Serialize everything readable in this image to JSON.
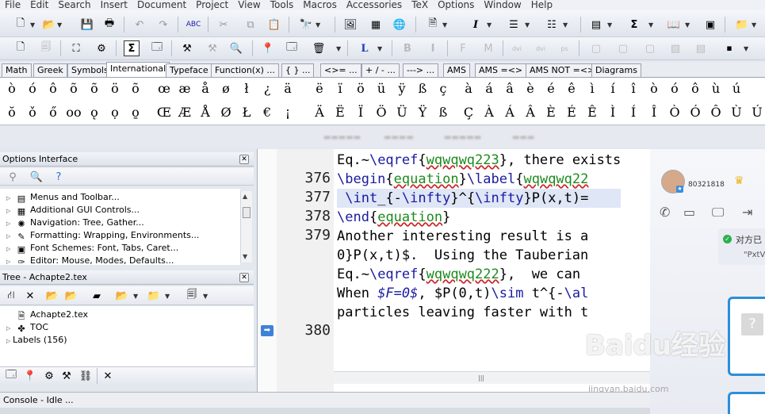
{
  "menu": [
    "File",
    "Edit",
    "Search",
    "Insert",
    "Document",
    "Project",
    "View",
    "Tools",
    "Macros",
    "Accessories",
    "TeX",
    "Options",
    "Window",
    "Help"
  ],
  "symbol_tabs": [
    "Math",
    "Greek",
    "Symbols",
    "International",
    "Typeface",
    "Function(x) ...",
    "{ } ...",
    "<>= ...",
    "+ / - ...",
    "---> ...",
    "AMS",
    "AMS =<>",
    "AMS NOT =<>",
    "Diagrams"
  ],
  "active_symbol_tab": "International",
  "symbols_row1": [
    "ò",
    "ó",
    "ô",
    "õ",
    "õ",
    "ö",
    "õ",
    "œ",
    "æ",
    "å",
    "ø",
    "ł",
    "¿",
    "ä",
    "ë",
    "ï",
    "ö",
    "ü",
    "ÿ",
    "ß",
    "ç",
    "à",
    "á",
    "â",
    "è",
    "é",
    "ê",
    "ì",
    "í",
    "î",
    "ò",
    "ó",
    "ô",
    "ù",
    "ú"
  ],
  "symbols_row2": [
    "ŏ",
    "ǒ",
    "ő",
    "oo",
    "ǫ",
    "ọ",
    "o̱",
    "Œ",
    "Æ",
    "Å",
    "Ø",
    "Ł",
    "€",
    "¡",
    "Ä",
    "Ë",
    "Ï",
    "Ö",
    "Ü",
    "Ÿ",
    "ß",
    "Ç",
    "À",
    "Á",
    "Â",
    "È",
    "É",
    "Ê",
    "Ì",
    "Í",
    "Î",
    "Ò",
    "Ó",
    "Ô",
    "Ù",
    "Ú"
  ],
  "options_panel": {
    "title": "Options Interface",
    "items": [
      "Menus and Toolbar...",
      "Additional GUI Controls...",
      "Navigation: Tree, Gather...",
      "Formatting: Wrapping, Environments...",
      "Font Schemes: Font, Tabs, Caret...",
      "Editor: Mouse, Modes, Defaults..."
    ]
  },
  "tree_panel": {
    "title": "Tree - Achapte2.tex",
    "items": [
      "Achapte2.tex",
      "TOC",
      "Labels  (156)"
    ]
  },
  "editor": {
    "line_numbers": [
      "",
      "376",
      "377",
      "378",
      "379",
      "",
      "",
      "",
      "",
      "380"
    ],
    "lines": [
      "Eq.~\\eqref{wqwqwq223}, there exists",
      "\\begin{equation}\\label{wqwqwq22",
      " \\int_{-\\infty}^{\\infty}P(x,t)=",
      "\\end{equation}",
      "Another interesting result is a",
      "0}P(x,t)$.  Using the Tauberian",
      "Eq.~\\eqref{wqwqwq222},  we can",
      "When $F=0$, $P(0,t)\\sim t^{-\\al",
      "particles leaving faster with t",
      ""
    ]
  },
  "chat": {
    "id": "80321818",
    "status_line1": "对方已",
    "status_line2": "\"PxtV"
  },
  "console": "Console - Idle ...",
  "watermark": "Baidu经验",
  "watermark_url": "jingyan.baidu.com",
  "colors": {
    "keyword": "#1a1aa0",
    "env": "#1d8a1d",
    "accent": "#2d8ed8"
  }
}
